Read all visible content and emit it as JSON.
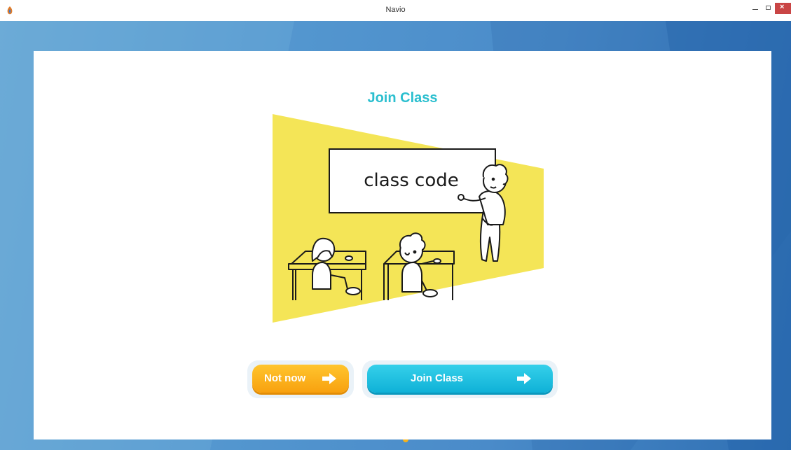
{
  "window": {
    "title": "Navio",
    "close_glyph": "×"
  },
  "dialog": {
    "heading": "Join Class",
    "illustration_text": "class code",
    "illustration": "classroom-illustration"
  },
  "buttons": {
    "not_now": "Not now",
    "join": "Join Class"
  },
  "colors": {
    "heading": "#2bbfcf",
    "not_now": "#f8a10f",
    "join": "#0fb1d7",
    "spotlight": "#f4e557",
    "backdrop": "#4a8bc9"
  },
  "icons": {
    "app": "navio-logo-icon",
    "arrow": "arrow-right-icon"
  }
}
